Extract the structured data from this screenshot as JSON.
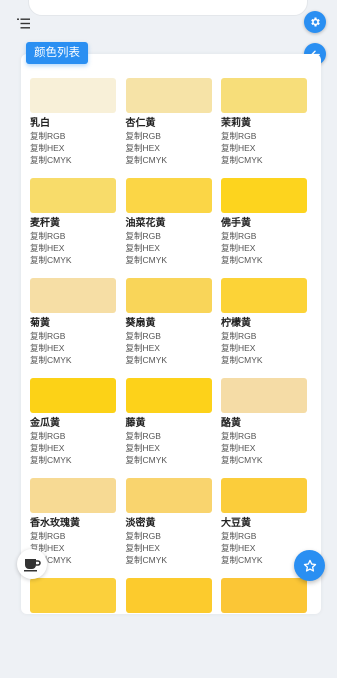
{
  "header": {
    "menu_icon": "menu-icon",
    "settings_icon": "gear-icon",
    "back_icon": "arrow-left-icon"
  },
  "section": {
    "title": "颜色列表"
  },
  "colors": [
    {
      "name": "乳白",
      "color": "#f8f0d8"
    },
    {
      "name": "杏仁黄",
      "color": "#f6e3a7"
    },
    {
      "name": "茉莉黄",
      "color": "#f7de7a"
    },
    {
      "name": "麦秆黄",
      "color": "#f8dc6a"
    },
    {
      "name": "油菜花黄",
      "color": "#fbd646"
    },
    {
      "name": "佛手黄",
      "color": "#fdd41e"
    },
    {
      "name": "菊黄",
      "color": "#f6dea5"
    },
    {
      "name": "葵扇黄",
      "color": "#f9d559"
    },
    {
      "name": "柠檬黄",
      "color": "#fcd337"
    },
    {
      "name": "金瓜黄",
      "color": "#fcd217"
    },
    {
      "name": "藤黄",
      "color": "#fdd21a"
    },
    {
      "name": "酪黄",
      "color": "#f5dca6"
    },
    {
      "name": "香水玫瑰黄",
      "color": "#f7da94"
    },
    {
      "name": "淡密黄",
      "color": "#f9d46e"
    },
    {
      "name": "大豆黄",
      "color": "#fbcd3b"
    },
    {
      "name": "",
      "color": "#fbd03c"
    },
    {
      "name": "",
      "color": "#fccb2d"
    },
    {
      "name": "",
      "color": "#fbc636"
    }
  ],
  "copy_labels": {
    "rgb": "复制RGB",
    "hex": "复制HEX",
    "cmyk": "复制CMYK"
  },
  "fab": {
    "coffee_icon": "coffee-cup-icon",
    "star_icon": "star-icon"
  },
  "theme": {
    "accent": "#2a8ff2",
    "background": "#eef1f5"
  }
}
